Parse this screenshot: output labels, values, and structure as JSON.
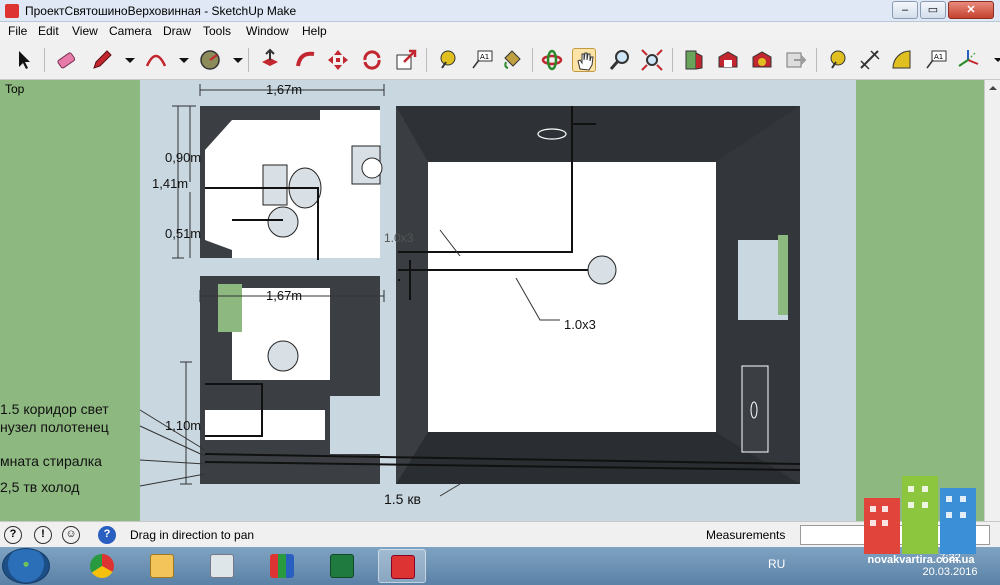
{
  "window": {
    "title": "ПроектСвятошиноВерховинная - SketchUp Make"
  },
  "menu": [
    "File",
    "Edit",
    "View",
    "Camera",
    "Draw",
    "Tools",
    "Window",
    "Help"
  ],
  "toolbar": {
    "tools": [
      "select",
      "eraser",
      "pencil",
      "arc",
      "circle",
      "push-pull",
      "follow-me",
      "move",
      "rotate",
      "scale",
      "tape-measure",
      "text",
      "paint-bucket",
      "orbit",
      "pan",
      "zoom",
      "zoom-extents",
      "components",
      "warehouse",
      "extension",
      "dimension",
      "axes",
      "protractor",
      "3d-text",
      "section-plane"
    ]
  },
  "viewport": {
    "view_name": "Top",
    "dimensions": [
      "1,67m",
      "0,90m",
      "1,41m",
      "0,51m",
      "1,67m",
      "1,10m"
    ],
    "labels": {
      "l1": "1.0x3",
      "l2": "1.0x3",
      "l3": "1.5 коридор свет",
      "l4": "нузел полотенец",
      "l5": "мната стиралка",
      "l6": "2,5 тв холод",
      "l7": "1.5 кв"
    }
  },
  "status": {
    "hint": "Drag in direction to pan",
    "measurements_label": "Measurements",
    "measurements_value": ""
  },
  "taskbar": {
    "apps": [
      "chrome",
      "explorer",
      "calculator",
      "apps",
      "excel",
      "sketchup"
    ],
    "lang": "RU",
    "time": "7:32",
    "date": "20.03.2016"
  },
  "watermark": {
    "text": "novakvartira.com.ua"
  }
}
